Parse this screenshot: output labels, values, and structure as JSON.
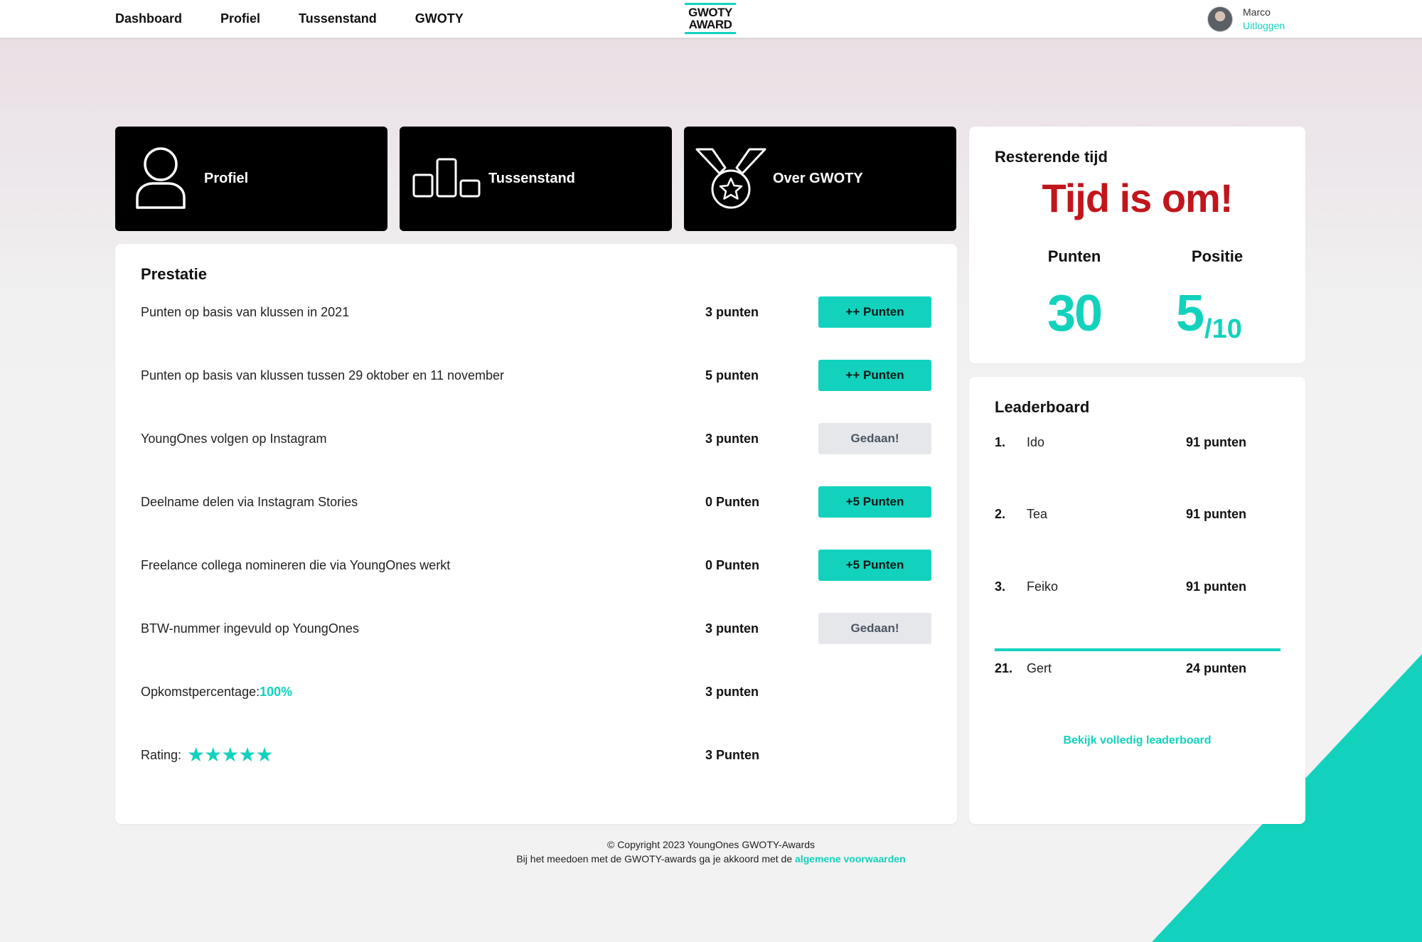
{
  "nav": {
    "links": [
      "Dashboard",
      "Profiel",
      "Tussenstand",
      "GWOTY"
    ],
    "logo_line1": "GWOTY",
    "logo_line2": "AWARD",
    "user_name": "Marco",
    "logout": "Uitloggen"
  },
  "tiles": [
    {
      "label": "Profiel",
      "icon": "user-icon"
    },
    {
      "label": "Tussenstand",
      "icon": "bar-chart-icon"
    },
    {
      "label": "Over GWOTY",
      "icon": "medal-icon"
    }
  ],
  "prestatie": {
    "title": "Prestatie",
    "rows": [
      {
        "label": "Punten op basis van klussen in 2021",
        "points": "3 punten",
        "button": "++ Punten",
        "button_style": "teal"
      },
      {
        "label": "Punten op basis van klussen tussen 29 oktober en 11 november",
        "points": "5 punten",
        "button": "++ Punten",
        "button_style": "teal"
      },
      {
        "label": "YoungOnes volgen op Instagram",
        "points": "3 punten",
        "button": "Gedaan!",
        "button_style": "grey"
      },
      {
        "label": "Deelname delen via Instagram Stories",
        "points": "0 Punten",
        "button": "+5 Punten",
        "button_style": "teal"
      },
      {
        "label": "Freelance collega nomineren die via YoungOnes werkt",
        "points": "0 Punten",
        "button": "+5 Punten",
        "button_style": "teal"
      },
      {
        "label": "BTW-nummer ingevuld op YoungOnes",
        "points": "3 punten",
        "button": "Gedaan!",
        "button_style": "grey"
      }
    ],
    "attendance_label": "Opkomstpercentage:",
    "attendance_value": "100%",
    "attendance_points": "3 punten",
    "rating_label": "Rating:",
    "rating_stars": 5,
    "rating_points": "3 Punten"
  },
  "timer": {
    "title": "Resterende tijd",
    "status": "Tijd is om!",
    "points_label": "Punten",
    "points_value": "30",
    "position_label": "Positie",
    "position_value": "5",
    "position_total": "/10"
  },
  "leaderboard": {
    "title": "Leaderboard",
    "entries": [
      {
        "rank": "1.",
        "name": "Ido",
        "points": "91 punten"
      },
      {
        "rank": "2.",
        "name": "Tea",
        "points": "91 punten"
      },
      {
        "rank": "3.",
        "name": "Feiko",
        "points": "91 punten"
      }
    ],
    "self": {
      "rank": "21.",
      "name": "Gert",
      "points": "24 punten"
    },
    "link": "Bekijk volledig leaderboard"
  },
  "footer": {
    "copyright": "© Copyright 2023 YoungOnes GWOTY-Awards",
    "terms_prefix": "Bij het meedoen met de GWOTY-awards ga je akkoord met de ",
    "terms_link": "algemene voorwaarden"
  },
  "colors": {
    "accent": "#12d2bd",
    "alert": "#c0161c",
    "tile_bg": "#000000"
  }
}
